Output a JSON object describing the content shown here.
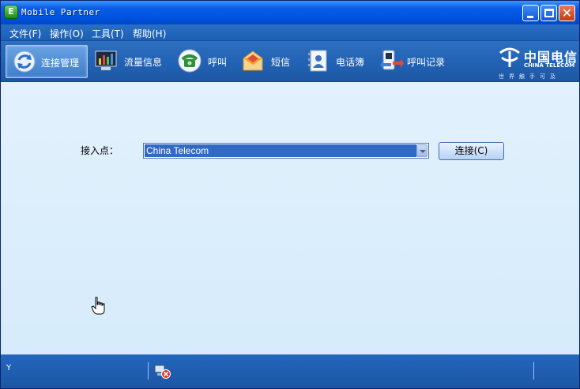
{
  "window": {
    "title": "Mobile Partner",
    "app_icon_letter": "E"
  },
  "menu": [
    {
      "label": "文件(F)"
    },
    {
      "label": "操作(O)"
    },
    {
      "label": "工具(T)"
    },
    {
      "label": "帮助(H)"
    }
  ],
  "toolbar": {
    "items": [
      {
        "label": "连接管理",
        "icon": "refresh-connection-icon",
        "active": true
      },
      {
        "label": "流量信息",
        "icon": "traffic-monitor-icon",
        "active": false
      },
      {
        "label": "呼叫",
        "icon": "telephone-icon",
        "active": false
      },
      {
        "label": "短信",
        "icon": "envelope-icon",
        "active": false
      },
      {
        "label": "电话簿",
        "icon": "phonebook-icon",
        "active": false
      },
      {
        "label": "呼叫记录",
        "icon": "call-log-icon",
        "active": false
      }
    ]
  },
  "brand": {
    "name_cn": "中国电信",
    "name_en": "CHINA TELECOM",
    "slogan": "世界触手可及"
  },
  "main": {
    "access_point_label": "接入点：",
    "access_point_value": "China Telecom",
    "connect_button": "连接(C)"
  },
  "status": {
    "signal_glyph": "Y",
    "network_icon": "network-disconnected-icon"
  },
  "colors": {
    "toolbar_blue": "#2262b4",
    "selection_blue": "#316ac5",
    "content_bg": "#dcefff"
  }
}
